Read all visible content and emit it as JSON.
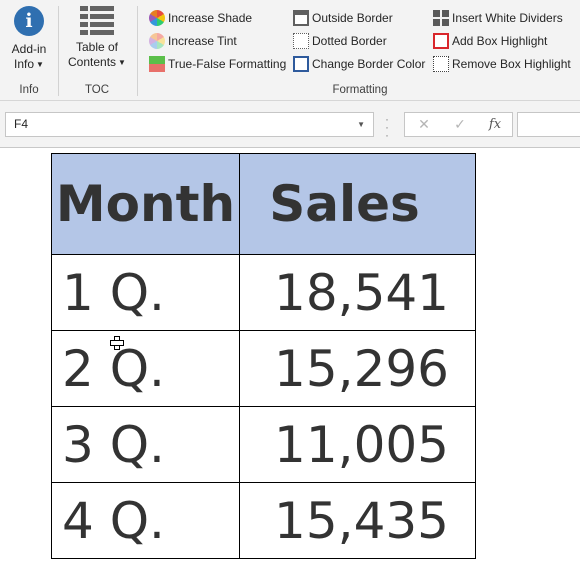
{
  "ribbon": {
    "info_group": {
      "button_line1": "Add-in",
      "button_line2": "Info",
      "caption": "Info"
    },
    "toc_group": {
      "button_line1": "Table of",
      "button_line2": "Contents",
      "caption": "TOC"
    },
    "formatting_group": {
      "caption": "Formatting",
      "col1": [
        "Increase Shade",
        "Increase Tint",
        "True-False Formatting"
      ],
      "col2": [
        "Outside Border",
        "Dotted Border",
        "Change Border Color"
      ],
      "col3": [
        "Insert White Dividers",
        "Add Box Highlight",
        "Remove Box Highlight"
      ]
    }
  },
  "formula_bar": {
    "name_box": "F4",
    "fx": "fx",
    "cancel": "✕",
    "enter": "✓"
  },
  "table": {
    "headers": [
      "Month",
      "Sales"
    ],
    "rows": [
      [
        "1 Q.",
        "18,541"
      ],
      [
        "2 Q.",
        "15,296"
      ],
      [
        "3 Q.",
        "11,005"
      ],
      [
        "4 Q.",
        "15,435"
      ]
    ]
  },
  "colors": {
    "header_fill": "#b4c6e7",
    "ribbon_bg": "#f3f3f3",
    "info_icon": "#2f6fb0",
    "highlight_red": "#d9262b"
  }
}
